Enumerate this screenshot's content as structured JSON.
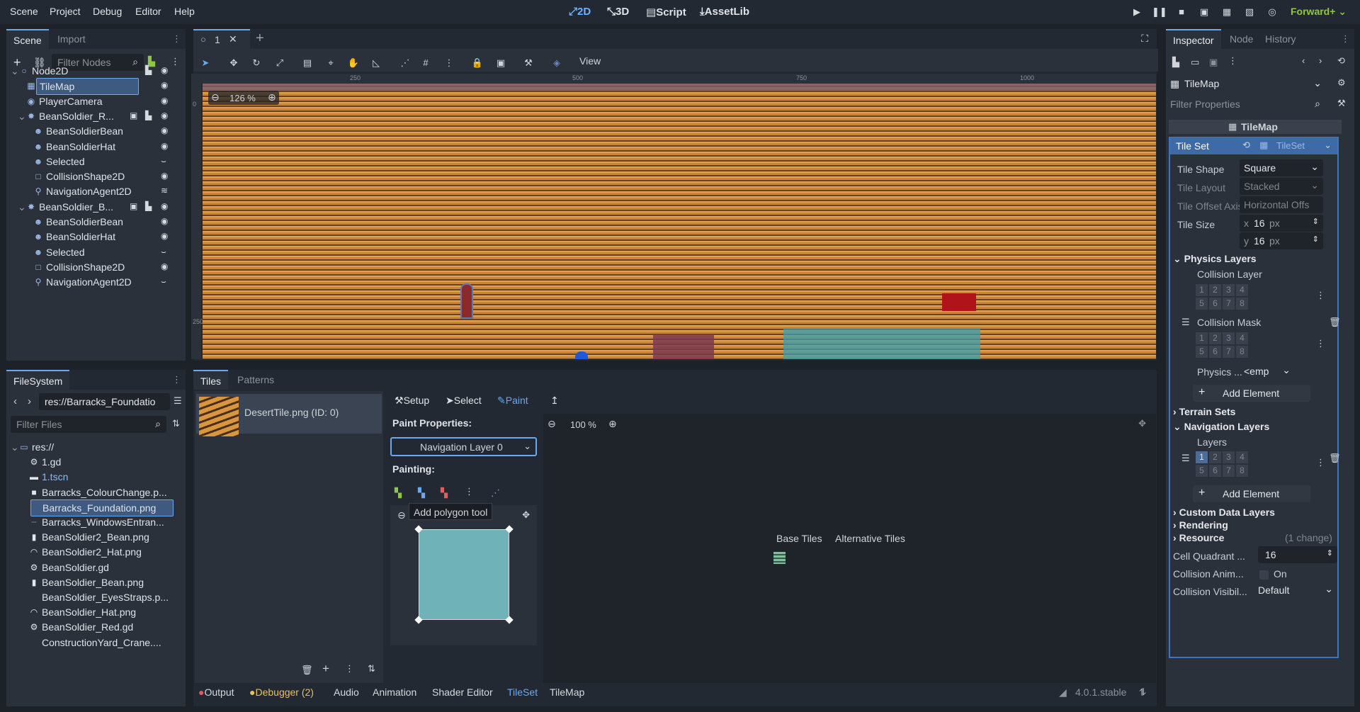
{
  "menus": [
    "Scene",
    "Project",
    "Debug",
    "Editor",
    "Help"
  ],
  "modes": {
    "2d": "2D",
    "3d": "3D",
    "script": "Script",
    "assetlib": "AssetLib"
  },
  "renderer": "Forward+",
  "scene_panel": {
    "tabs": [
      "Scene",
      "Import"
    ],
    "filter_placeholder": "Filter Nodes",
    "nodes": [
      "Node2D",
      "TileMap",
      "PlayerCamera",
      "BeanSoldier_R...",
      "BeanSoldierBean",
      "BeanSoldierHat",
      "Selected",
      "CollisionShape2D",
      "NavigationAgent2D",
      "BeanSoldier_B...",
      "BeanSoldierBean",
      "BeanSoldierHat",
      "Selected",
      "CollisionShape2D",
      "NavigationAgent2D"
    ]
  },
  "filesystem": {
    "tab": "FileSystem",
    "path": "res://Barracks_Foundatio",
    "filter_placeholder": "Filter Files",
    "items": [
      "res://",
      "1.gd",
      "1.tscn",
      "Barracks_ColourChange.p...",
      "Barracks_Foundation.png",
      "Barracks_WindowsEntran...",
      "BeanSoldier2_Bean.png",
      "BeanSoldier2_Hat.png",
      "BeanSoldier.gd",
      "BeanSoldier_Bean.png",
      "BeanSoldier_EyesStraps.p...",
      "BeanSoldier_Hat.png",
      "BeanSoldier_Red.gd",
      "ConstructionYard_Crane...."
    ]
  },
  "viewport": {
    "tab": "1",
    "zoom": "126 %",
    "view_menu": "View",
    "ruler_ticks": [
      "250",
      "500",
      "750",
      "1000"
    ],
    "side_ticks": [
      "0",
      "250"
    ]
  },
  "tiles_panel": {
    "tabs": [
      "Tiles",
      "Patterns"
    ],
    "tile_name": "DesertTile.png (ID: 0)",
    "modes": [
      "Setup",
      "Select",
      "Paint"
    ],
    "paint_properties": "Paint Properties:",
    "layer_select": "Navigation Layer 0",
    "painting": "Painting:",
    "tooltip": "Add polygon tool",
    "atlas_zoom": "100 %",
    "base_tiles": "Base Tiles",
    "alt_tiles": "Alternative Tiles"
  },
  "bottom_tabs": [
    "Output",
    "Debugger (2)",
    "Audio",
    "Animation",
    "Shader Editor",
    "TileSet",
    "TileMap"
  ],
  "version": "4.0.1.stable",
  "inspector": {
    "tabs": [
      "Inspector",
      "Node",
      "History"
    ],
    "object": "TileMap",
    "filter_placeholder": "Filter Properties",
    "header": "TileMap",
    "tile_set_label": "Tile Set",
    "tile_set_value": "TileSet",
    "tile_shape_label": "Tile Shape",
    "tile_shape_value": "Square",
    "tile_layout_label": "Tile Layout",
    "tile_layout_value": "Stacked",
    "tile_offset_label": "Tile Offset Axis",
    "tile_offset_value": "Horizontal Offs",
    "tile_size_label": "Tile Size",
    "tile_size_x": "16",
    "tile_size_y": "16",
    "px": "px",
    "x": "x",
    "y": "y",
    "physics_layers": "Physics Layers",
    "collision_layer": "Collision Layer",
    "collision_mask": "Collision Mask",
    "physics_label": "Physics ...",
    "physics_value": "<emp",
    "add_element": "Add Element",
    "terrain_sets": "Terrain Sets",
    "navigation_layers": "Navigation Layers",
    "layers": "Layers",
    "custom_data": "Custom Data Layers",
    "rendering": "Rendering",
    "resource": "Resource",
    "resource_change": "(1 change)",
    "cell_quadrant_label": "Cell Quadrant ...",
    "cell_quadrant_value": "16",
    "collision_anim_label": "Collision Anim...",
    "collision_anim_value": "On",
    "collision_vis_label": "Collision Visibil...",
    "collision_vis_value": "Default",
    "grid_nums": [
      "1",
      "2",
      "3",
      "4",
      "5",
      "6",
      "7",
      "8"
    ]
  }
}
